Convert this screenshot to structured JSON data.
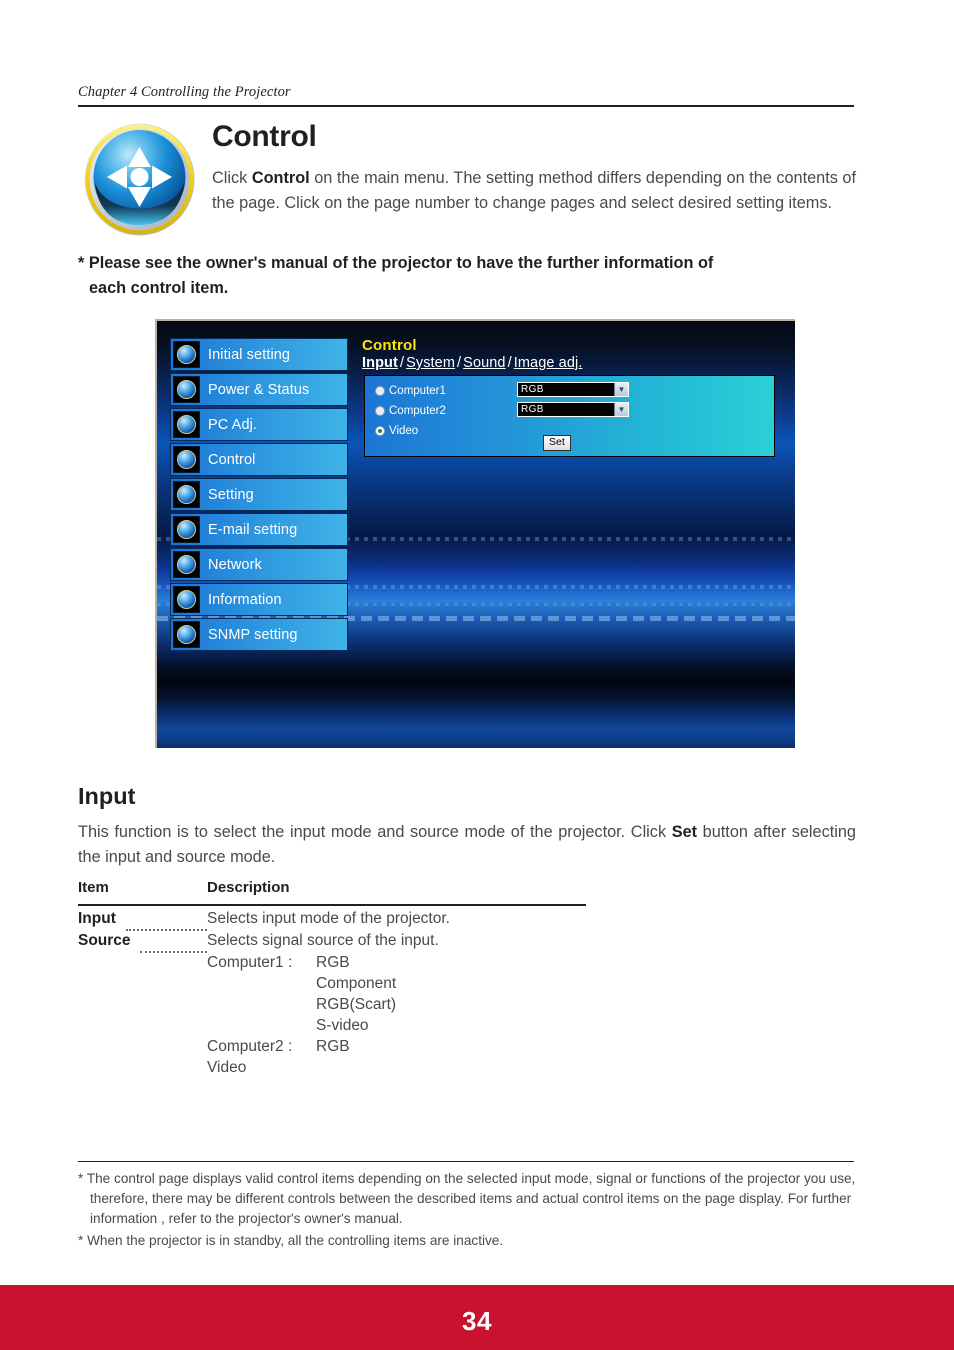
{
  "running_head": "Chapter 4 Controlling the Projector",
  "section": {
    "icon_name": "control-navigation-sphere-icon",
    "title": "Control",
    "intro_lead": "Click ",
    "intro_bold": "Control",
    "intro_rest": " on the main menu. The setting method differs depending on the contents of the page. Click on the page number to change pages and select desired setting items.",
    "note_line1": "* Please see the owner's manual of the projector to have the further information of",
    "note_line2": "each control item."
  },
  "screenshot": {
    "menu": [
      {
        "label": "Initial setting",
        "icon": "gear-sphere-icon"
      },
      {
        "label": "Power & Status",
        "icon": "power-sphere-icon"
      },
      {
        "label": "PC Adj.",
        "icon": "monitor-sphere-icon"
      },
      {
        "label": "Control",
        "icon": "dpad-sphere-icon"
      },
      {
        "label": "Setting",
        "icon": "wrench-sphere-icon"
      },
      {
        "label": "E-mail setting",
        "icon": "envelope-sphere-icon"
      },
      {
        "label": "Network",
        "icon": "network-sphere-icon"
      },
      {
        "label": "Information",
        "icon": "info-sphere-icon"
      },
      {
        "label": "SNMP setting",
        "icon": "snmp-sphere-icon"
      }
    ],
    "pane": {
      "title": "Control",
      "tabs": [
        {
          "label": "Input",
          "active": true
        },
        {
          "label": "System",
          "active": false
        },
        {
          "label": "Sound",
          "active": false
        },
        {
          "label": "Image adj.",
          "active": false
        }
      ],
      "tab_separator": "/",
      "rows": [
        {
          "label": "Computer1",
          "selected": false,
          "source": "RGB"
        },
        {
          "label": "Computer2",
          "selected": false,
          "source": "RGB"
        },
        {
          "label": "Video",
          "selected": true,
          "source": null
        }
      ],
      "set_button": "Set",
      "dropdown_arrow": "▼"
    }
  },
  "input_section": {
    "title": "Input",
    "description_a": "This function is to select the input mode and source mode of the projector.  Click ",
    "description_bold": "Set",
    "description_b": " button after selecting the input and source mode.",
    "table": {
      "headers": {
        "item": "Item",
        "description": "Description"
      },
      "rows": [
        {
          "item": "Input",
          "description": "Selects input mode of the projector."
        },
        {
          "item": "Source",
          "description": "Selects signal source of the input."
        }
      ],
      "source_detail": [
        {
          "key": "Computer1 :",
          "value": "RGB"
        },
        {
          "key": "",
          "value": "Component"
        },
        {
          "key": "",
          "value": "RGB(Scart)"
        },
        {
          "key": "",
          "value": "S-video"
        },
        {
          "key": "Computer2 :",
          "value": "RGB"
        },
        {
          "key": "Video",
          "value": ""
        }
      ]
    }
  },
  "footnotes": [
    "* The control page displays valid control items depending on the selected input mode, signal or  functions of the projector you use, therefore, there may be different controls between the described items and actual control items on the page display. For further information , refer to the projector's owner's manual.",
    "* When the projector is in standby, all the controlling items are inactive."
  ],
  "footer": {
    "page_number": "34",
    "band_color": "#c8122f"
  }
}
